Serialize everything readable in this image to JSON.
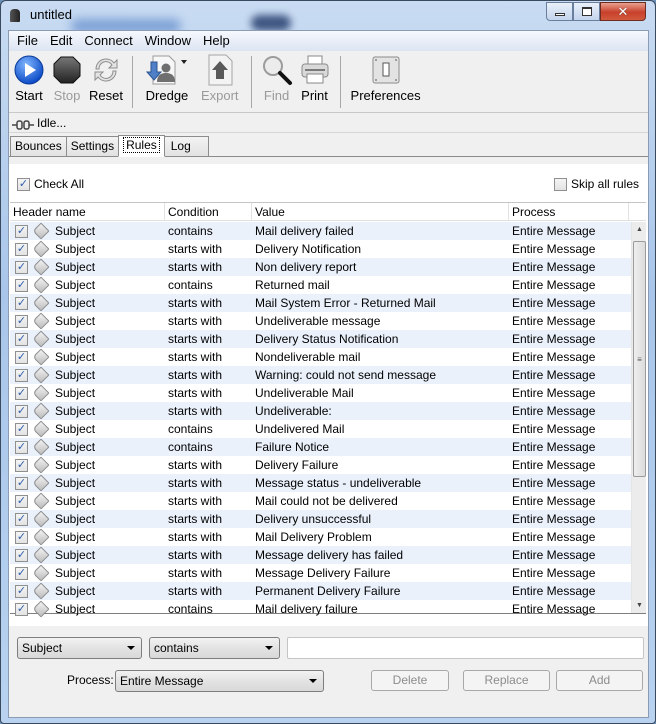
{
  "window": {
    "title": "untitled",
    "controls": {
      "minimize": "minimize",
      "maximize": "maximize",
      "close": "x"
    }
  },
  "menubar": [
    "File",
    "Edit",
    "Connect",
    "Window",
    "Help"
  ],
  "toolbar": {
    "start": {
      "label": "Start",
      "icon": "play-icon",
      "enabled": true
    },
    "stop": {
      "label": "Stop",
      "icon": "stop-icon",
      "enabled": false
    },
    "reset": {
      "label": "Reset",
      "icon": "refresh-icon",
      "enabled": true
    },
    "dredge": {
      "label": "Dredge",
      "icon": "dredge-icon",
      "enabled": true,
      "has_dropdown": true
    },
    "export": {
      "label": "Export",
      "icon": "export-icon",
      "enabled": false
    },
    "find": {
      "label": "Find",
      "icon": "magnifier-icon",
      "enabled": false
    },
    "print": {
      "label": "Print",
      "icon": "printer-icon",
      "enabled": true
    },
    "preferences": {
      "label": "Preferences",
      "icon": "switch-icon",
      "enabled": true
    }
  },
  "status": {
    "icon": "plug-icon",
    "text": "Idle..."
  },
  "tabs": [
    {
      "label": "Bounces",
      "active": false
    },
    {
      "label": "Settings",
      "active": false
    },
    {
      "label": "Rules",
      "active": true
    },
    {
      "label": "Log",
      "active": false
    }
  ],
  "rules_panel": {
    "check_all": {
      "label": "Check All",
      "checked": true
    },
    "skip_all": {
      "label": "Skip all rules",
      "checked": false
    },
    "columns": [
      "Header name",
      "Condition",
      "Value",
      "Process"
    ],
    "rows": [
      {
        "checked": true,
        "header": "Subject",
        "condition": "contains",
        "value": "Mail delivery failed",
        "process": "Entire Message"
      },
      {
        "checked": true,
        "header": "Subject",
        "condition": "starts with",
        "value": "Delivery Notification",
        "process": "Entire Message"
      },
      {
        "checked": true,
        "header": "Subject",
        "condition": "starts with",
        "value": "Non delivery report",
        "process": "Entire Message"
      },
      {
        "checked": true,
        "header": "Subject",
        "condition": "contains",
        "value": "Returned mail",
        "process": "Entire Message"
      },
      {
        "checked": true,
        "header": "Subject",
        "condition": "starts with",
        "value": "Mail System Error - Returned Mail",
        "process": "Entire Message"
      },
      {
        "checked": true,
        "header": "Subject",
        "condition": "starts with",
        "value": "Undeliverable message",
        "process": "Entire Message"
      },
      {
        "checked": true,
        "header": "Subject",
        "condition": "starts with",
        "value": "Delivery Status Notification",
        "process": "Entire Message"
      },
      {
        "checked": true,
        "header": "Subject",
        "condition": "starts with",
        "value": "Nondeliverable mail",
        "process": "Entire Message"
      },
      {
        "checked": true,
        "header": "Subject",
        "condition": "starts with",
        "value": "Warning: could not send message",
        "process": "Entire Message"
      },
      {
        "checked": true,
        "header": "Subject",
        "condition": "starts with",
        "value": "Undeliverable Mail",
        "process": "Entire Message"
      },
      {
        "checked": true,
        "header": "Subject",
        "condition": "starts with",
        "value": "Undeliverable:",
        "process": "Entire Message"
      },
      {
        "checked": true,
        "header": "Subject",
        "condition": "contains",
        "value": "Undelivered Mail",
        "process": "Entire Message"
      },
      {
        "checked": true,
        "header": "Subject",
        "condition": "contains",
        "value": "Failure Notice",
        "process": "Entire Message"
      },
      {
        "checked": true,
        "header": "Subject",
        "condition": "starts with",
        "value": "Delivery Failure",
        "process": "Entire Message"
      },
      {
        "checked": true,
        "header": "Subject",
        "condition": "starts with",
        "value": "Message status - undeliverable",
        "process": "Entire Message"
      },
      {
        "checked": true,
        "header": "Subject",
        "condition": "starts with",
        "value": "Mail could not be delivered",
        "process": "Entire Message"
      },
      {
        "checked": true,
        "header": "Subject",
        "condition": "starts with",
        "value": "Delivery unsuccessful",
        "process": "Entire Message"
      },
      {
        "checked": true,
        "header": "Subject",
        "condition": "starts with",
        "value": "Mail Delivery Problem",
        "process": "Entire Message"
      },
      {
        "checked": true,
        "header": "Subject",
        "condition": "starts with",
        "value": "Message delivery has failed",
        "process": "Entire Message"
      },
      {
        "checked": true,
        "header": "Subject",
        "condition": "starts with",
        "value": "Message Delivery Failure",
        "process": "Entire Message"
      },
      {
        "checked": true,
        "header": "Subject",
        "condition": "starts with",
        "value": "Permanent Delivery Failure",
        "process": "Entire Message"
      },
      {
        "checked": true,
        "header": "Subject",
        "condition": "contains",
        "value": "Mail delivery failure",
        "process": "Entire Message"
      }
    ]
  },
  "editor": {
    "header_select": "Subject",
    "condition_select": "contains",
    "value_input": "",
    "process_label": "Process:",
    "process_select": "Entire Message",
    "buttons": {
      "delete": "Delete",
      "replace": "Replace",
      "add": "Add"
    }
  }
}
